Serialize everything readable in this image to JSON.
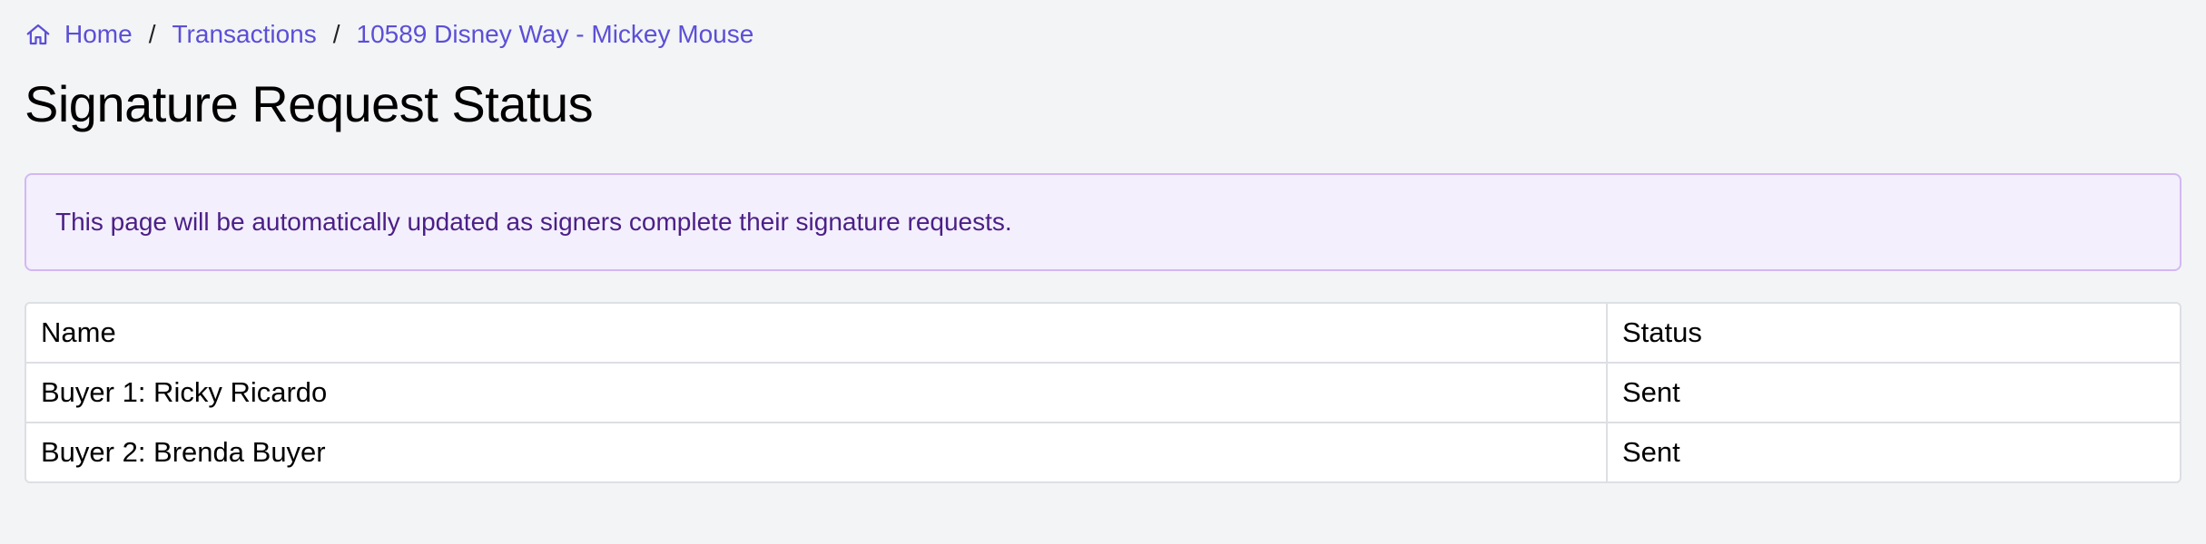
{
  "breadcrumb": {
    "home_icon": "home-icon",
    "items": [
      {
        "label": "Home"
      },
      {
        "label": "Transactions"
      },
      {
        "label": "10589 Disney Way - Mickey Mouse"
      }
    ],
    "separator": "/"
  },
  "page": {
    "title": "Signature Request Status"
  },
  "notice": {
    "text": "This page will be automatically updated as signers complete their signature requests."
  },
  "table": {
    "columns": [
      "Name",
      "Status"
    ],
    "rows": [
      {
        "name": "Buyer 1: Ricky Ricardo",
        "status": "Sent"
      },
      {
        "name": "Buyer 2: Brenda Buyer",
        "status": "Sent"
      }
    ]
  },
  "colors": {
    "link": "#5b4fd6",
    "notice_bg": "#f3effd",
    "notice_border": "#d3b8f3",
    "notice_text": "#4b1f86",
    "page_bg": "#f3f4f6"
  }
}
